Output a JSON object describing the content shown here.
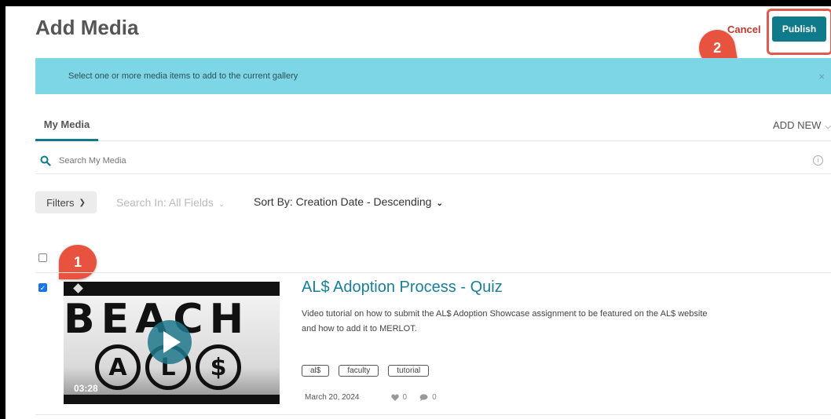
{
  "header": {
    "title": "Add Media",
    "cancel_label": "Cancel",
    "publish_label": "Publish"
  },
  "annotations": {
    "step1": "1",
    "step2": "2"
  },
  "banner": {
    "message": "Select one or more media items to add to the current gallery",
    "close_symbol": "×"
  },
  "tabs": {
    "active_label": "My Media",
    "add_new_label": "ADD NEW"
  },
  "search": {
    "placeholder": "Search My Media",
    "info_symbol": "i"
  },
  "filters": {
    "filters_label": "Filters",
    "search_in_label": "Search In: All Fields",
    "sort_by_label": "Sort By: Creation Date - Descending"
  },
  "media_item": {
    "title": "AL$ Adoption Process - Quiz",
    "description": "Video tutorial on how to submit the AL$ Adoption Showcase assignment to be featured on the AL$ website and how to add it to MERLOT.",
    "duration": "03:28",
    "thumbnail_text": "BEACH",
    "thumbnail_letters": [
      "A",
      "L",
      "$"
    ],
    "tags": [
      "al$",
      "faculty",
      "tutorial"
    ],
    "date": "March 20, 2024",
    "likes": "0",
    "comments": "0",
    "selected": true
  },
  "colors": {
    "accent": "#0e7a8a",
    "banner": "#7dd6e6",
    "cancel": "#c0392b",
    "marker": "#e8533f"
  }
}
